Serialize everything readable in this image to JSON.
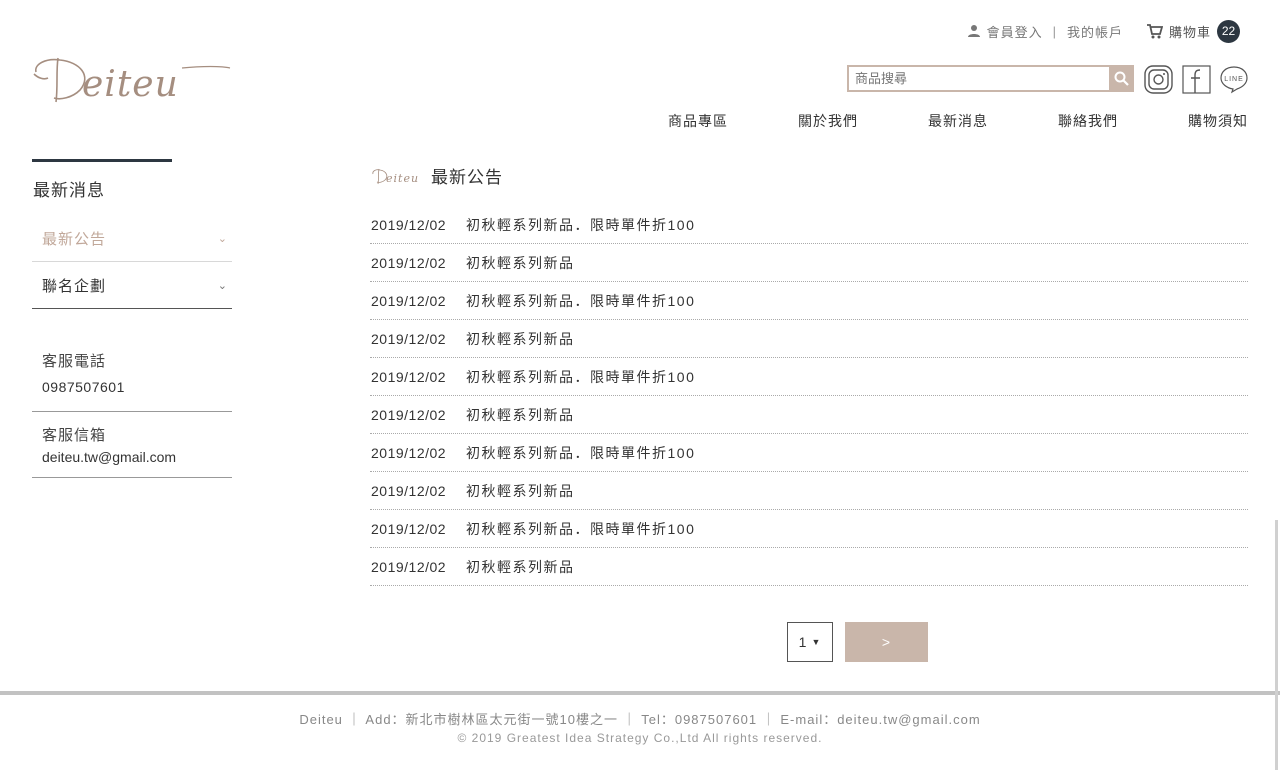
{
  "header": {
    "login_label": "會員登入",
    "separator": "|",
    "account_label": "我的帳戶",
    "cart_label": "購物車",
    "cart_count": "22",
    "brand_color": "#c9b6aa"
  },
  "logo": {
    "text": "Deiteu"
  },
  "search": {
    "placeholder": "商品搜尋",
    "value": ""
  },
  "social": [
    "instagram-icon",
    "facebook-icon",
    "line-icon"
  ],
  "nav": {
    "items": [
      "商品專區",
      "關於我們",
      "最新消息",
      "聯絡我們",
      "購物須知"
    ]
  },
  "sidebar": {
    "title": "最新消息",
    "items": [
      {
        "label": "最新公告",
        "active": true
      },
      {
        "label": "聯名企劃",
        "active": false
      }
    ],
    "phone_label": "客服電話",
    "phone": "0987507601",
    "email_label": "客服信箱",
    "email": "deiteu.tw@gmail.com"
  },
  "main": {
    "heading_logo": "Deiteu",
    "heading": "最新公告",
    "news": [
      {
        "date": "2019/12/02",
        "title": "初秋輕系列新品．限時單件折100"
      },
      {
        "date": "2019/12/02",
        "title": "初秋輕系列新品"
      },
      {
        "date": "2019/12/02",
        "title": "初秋輕系列新品．限時單件折100"
      },
      {
        "date": "2019/12/02",
        "title": "初秋輕系列新品"
      },
      {
        "date": "2019/12/02",
        "title": "初秋輕系列新品．限時單件折100"
      },
      {
        "date": "2019/12/02",
        "title": "初秋輕系列新品"
      },
      {
        "date": "2019/12/02",
        "title": "初秋輕系列新品．限時單件折100"
      },
      {
        "date": "2019/12/02",
        "title": "初秋輕系列新品"
      },
      {
        "date": "2019/12/02",
        "title": "初秋輕系列新品．限時單件折100"
      },
      {
        "date": "2019/12/02",
        "title": "初秋輕系列新品"
      }
    ]
  },
  "pagination": {
    "page": "1",
    "next_label": ">"
  },
  "footer": {
    "line1": "Deiteu ｜ Add：新北市樹林區太元街一號10樓之一 ｜ Tel：0987507601 ｜ E-mail：deiteu.tw@gmail.com",
    "line2": "© 2019 Greatest Idea Strategy Co.,Ltd All rights reserved."
  }
}
